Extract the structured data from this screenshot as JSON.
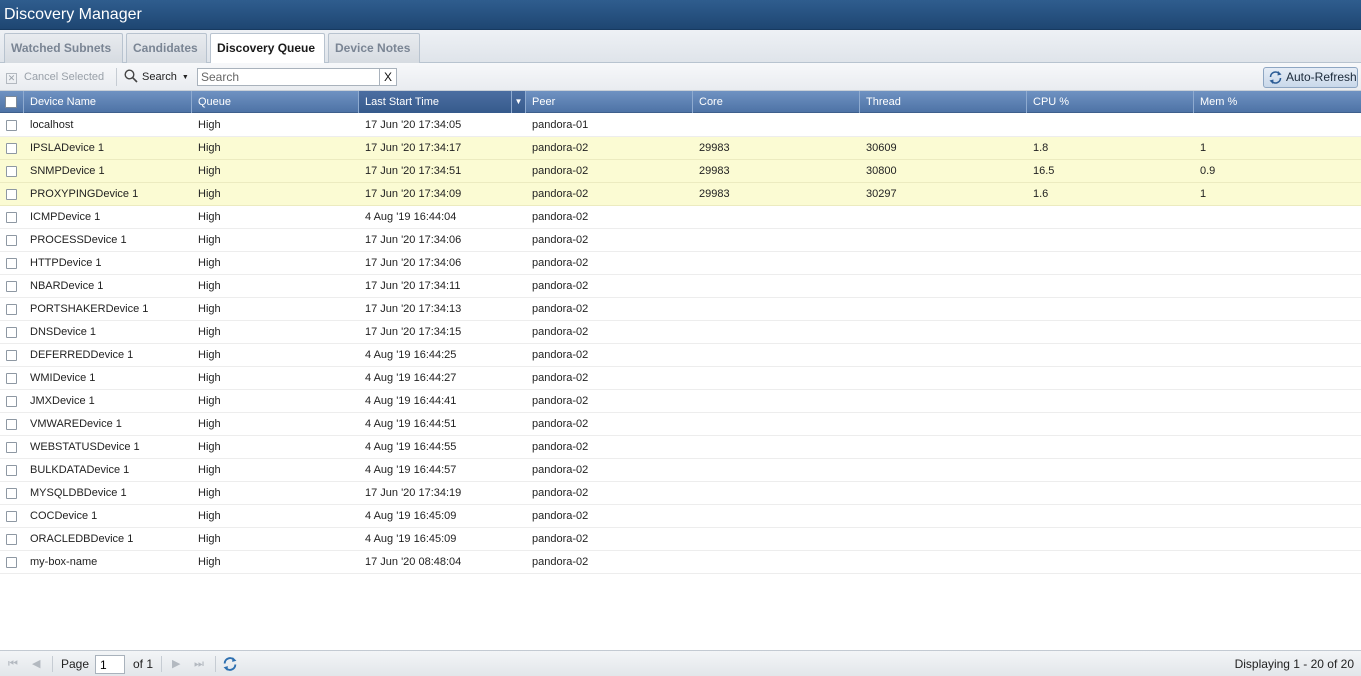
{
  "app": {
    "title": "Discovery Manager"
  },
  "tabs": [
    {
      "label": "Watched Subnets"
    },
    {
      "label": "Candidates"
    },
    {
      "label": "Discovery Queue"
    },
    {
      "label": "Device Notes"
    }
  ],
  "toolbar": {
    "cancel_label": "Cancel Selected",
    "search_label": "Search",
    "search_placeholder": "Search",
    "clear_label": "X",
    "autorefresh_label": "Auto-Refresh"
  },
  "grid": {
    "columns": [
      "Device Name",
      "Queue",
      "Last Start Time",
      "Peer",
      "Core",
      "Thread",
      "CPU %",
      "Mem %"
    ],
    "rows": [
      {
        "device": "localhost",
        "queue": "High",
        "time": "17 Jun '20 17:34:05",
        "peer": "pandora-01",
        "core": "",
        "thread": "",
        "cpu": "",
        "mem": "",
        "highlight": false
      },
      {
        "device": "IPSLADevice 1",
        "queue": "High",
        "time": "17 Jun '20 17:34:17",
        "peer": "pandora-02",
        "core": "29983",
        "thread": "30609",
        "cpu": "1.8",
        "mem": "1",
        "highlight": true
      },
      {
        "device": "SNMPDevice 1",
        "queue": "High",
        "time": "17 Jun '20 17:34:51",
        "peer": "pandora-02",
        "core": "29983",
        "thread": "30800",
        "cpu": "16.5",
        "mem": "0.9",
        "highlight": true
      },
      {
        "device": "PROXYPINGDevice 1",
        "queue": "High",
        "time": "17 Jun '20 17:34:09",
        "peer": "pandora-02",
        "core": "29983",
        "thread": "30297",
        "cpu": "1.6",
        "mem": "1",
        "highlight": true
      },
      {
        "device": "ICMPDevice 1",
        "queue": "High",
        "time": "4 Aug '19 16:44:04",
        "peer": "pandora-02",
        "core": "",
        "thread": "",
        "cpu": "",
        "mem": "",
        "highlight": false
      },
      {
        "device": "PROCESSDevice 1",
        "queue": "High",
        "time": "17 Jun '20 17:34:06",
        "peer": "pandora-02",
        "core": "",
        "thread": "",
        "cpu": "",
        "mem": "",
        "highlight": false
      },
      {
        "device": "HTTPDevice 1",
        "queue": "High",
        "time": "17 Jun '20 17:34:06",
        "peer": "pandora-02",
        "core": "",
        "thread": "",
        "cpu": "",
        "mem": "",
        "highlight": false
      },
      {
        "device": "NBARDevice 1",
        "queue": "High",
        "time": "17 Jun '20 17:34:11",
        "peer": "pandora-02",
        "core": "",
        "thread": "",
        "cpu": "",
        "mem": "",
        "highlight": false
      },
      {
        "device": "PORTSHAKERDevice 1",
        "queue": "High",
        "time": "17 Jun '20 17:34:13",
        "peer": "pandora-02",
        "core": "",
        "thread": "",
        "cpu": "",
        "mem": "",
        "highlight": false
      },
      {
        "device": "DNSDevice 1",
        "queue": "High",
        "time": "17 Jun '20 17:34:15",
        "peer": "pandora-02",
        "core": "",
        "thread": "",
        "cpu": "",
        "mem": "",
        "highlight": false
      },
      {
        "device": "DEFERREDDevice 1",
        "queue": "High",
        "time": "4 Aug '19 16:44:25",
        "peer": "pandora-02",
        "core": "",
        "thread": "",
        "cpu": "",
        "mem": "",
        "highlight": false
      },
      {
        "device": "WMIDevice 1",
        "queue": "High",
        "time": "4 Aug '19 16:44:27",
        "peer": "pandora-02",
        "core": "",
        "thread": "",
        "cpu": "",
        "mem": "",
        "highlight": false
      },
      {
        "device": "JMXDevice 1",
        "queue": "High",
        "time": "4 Aug '19 16:44:41",
        "peer": "pandora-02",
        "core": "",
        "thread": "",
        "cpu": "",
        "mem": "",
        "highlight": false
      },
      {
        "device": "VMWAREDevice 1",
        "queue": "High",
        "time": "4 Aug '19 16:44:51",
        "peer": "pandora-02",
        "core": "",
        "thread": "",
        "cpu": "",
        "mem": "",
        "highlight": false
      },
      {
        "device": "WEBSTATUSDevice 1",
        "queue": "High",
        "time": "4 Aug '19 16:44:55",
        "peer": "pandora-02",
        "core": "",
        "thread": "",
        "cpu": "",
        "mem": "",
        "highlight": false
      },
      {
        "device": "BULKDATADevice 1",
        "queue": "High",
        "time": "4 Aug '19 16:44:57",
        "peer": "pandora-02",
        "core": "",
        "thread": "",
        "cpu": "",
        "mem": "",
        "highlight": false
      },
      {
        "device": "MYSQLDBDevice 1",
        "queue": "High",
        "time": "17 Jun '20 17:34:19",
        "peer": "pandora-02",
        "core": "",
        "thread": "",
        "cpu": "",
        "mem": "",
        "highlight": false
      },
      {
        "device": "COCDevice 1",
        "queue": "High",
        "time": "4 Aug '19 16:45:09",
        "peer": "pandora-02",
        "core": "",
        "thread": "",
        "cpu": "",
        "mem": "",
        "highlight": false
      },
      {
        "device": "ORACLEDBDevice 1",
        "queue": "High",
        "time": "4 Aug '19 16:45:09",
        "peer": "pandora-02",
        "core": "",
        "thread": "",
        "cpu": "",
        "mem": "",
        "highlight": false
      },
      {
        "device": "my-box-name",
        "queue": "High",
        "time": "17 Jun '20 08:48:04",
        "peer": "pandora-02",
        "core": "",
        "thread": "",
        "cpu": "",
        "mem": "",
        "highlight": false
      }
    ]
  },
  "pager": {
    "page_label": "Page",
    "page_value": "1",
    "of_label": "of 1",
    "display_label": "Displaying 1 - 20 of 20"
  },
  "colors": {
    "highlight_row": "#fbfbd3",
    "header_bg": "#4e73a6",
    "title_bg": "#1e4672"
  }
}
